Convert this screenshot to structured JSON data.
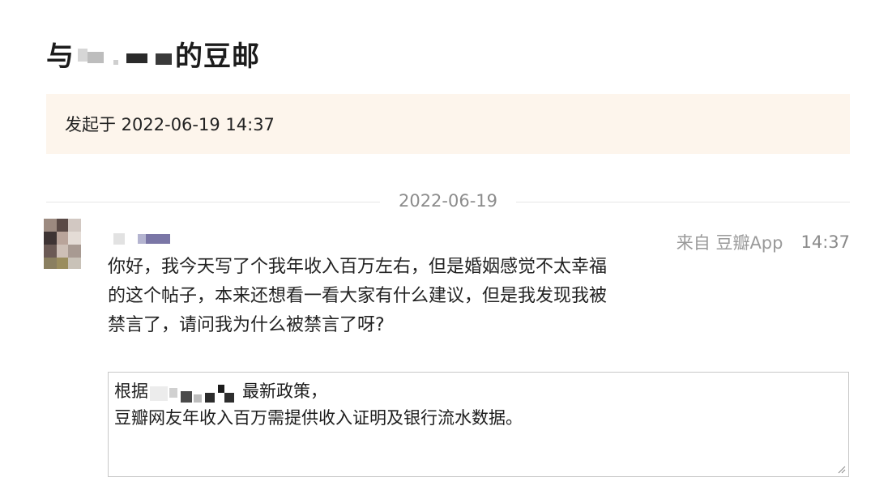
{
  "header": {
    "title_prefix": "与",
    "title_suffix": "的豆邮"
  },
  "conversation": {
    "started_text": "发起于 2022-06-19 14:37",
    "date_divider": "2022-06-19"
  },
  "message": {
    "source_label": "来自 豆瓣App",
    "time": "14:37",
    "lines": [
      "你好，我今天写了个我年收入百万左右，但是婚姻感觉不太幸福",
      "的这个帖子，本来还想看一看大家有什么建议，但是我发现我被",
      "禁言了，请问我为什么被禁言了呀?"
    ]
  },
  "reply": {
    "line1_prefix": "根据",
    "line1_suffix": "最新政策，",
    "line2": "豆瓣网友年收入百万需提供收入证明及银行流水数据。"
  },
  "icons": {
    "resize_handle": "resize-handle-icon"
  },
  "colors": {
    "info_box_bg": "#fdf5ec",
    "divider": "#e6e6e6",
    "meta_text": "#9a9a9a",
    "border": "#c8c8c8"
  }
}
